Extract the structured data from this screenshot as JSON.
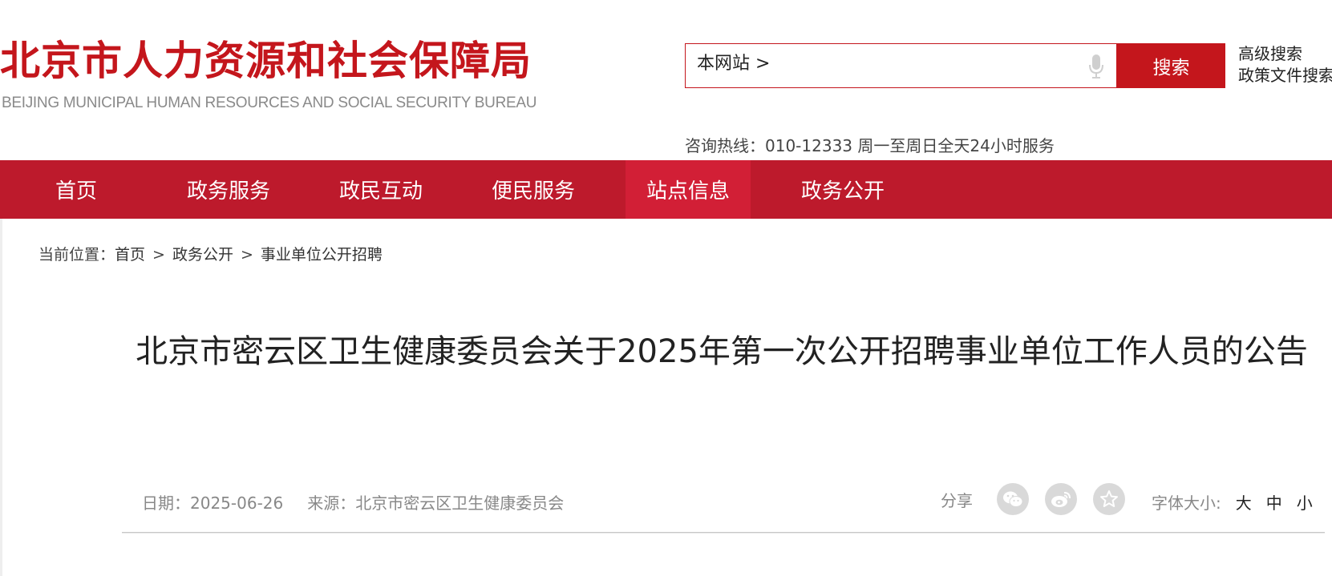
{
  "header": {
    "logo_cn": "北京市人力资源和社会保障局",
    "logo_en": "BEIJING MUNICIPAL HUMAN RESOURCES AND SOCIAL SECURITY BUREAU",
    "search_scope": "本网站 >",
    "search_placeholder": "",
    "search_button": "搜索",
    "advanced_search": "高级搜索",
    "policy_search": "政策文件搜索",
    "hotline": "咨询热线：010-12333 周一至周日全天24小时服务"
  },
  "nav": {
    "items": [
      {
        "label": "首页"
      },
      {
        "label": "政务服务"
      },
      {
        "label": "政民互动"
      },
      {
        "label": "便民服务"
      },
      {
        "label": "站点信息"
      },
      {
        "label": "政务公开"
      }
    ]
  },
  "breadcrumb": {
    "prefix": "当前位置：",
    "items": [
      "首页",
      "政务公开",
      "事业单位公开招聘"
    ],
    "separator": ">"
  },
  "article": {
    "title": "北京市密云区卫生健康委员会关于2025年第一次公开招聘事业单位工作人员的公告",
    "date": "日期：2025-06-26",
    "source": "来源：北京市密云区卫生健康委员会",
    "share_label": "分享",
    "font_size_label": "字体大小:",
    "font_sizes": [
      "大",
      "中",
      "小"
    ]
  },
  "colors": {
    "brand_red": "#c4161c",
    "nav_red": "#bd1a2c",
    "nav_active": "#d21f36"
  }
}
